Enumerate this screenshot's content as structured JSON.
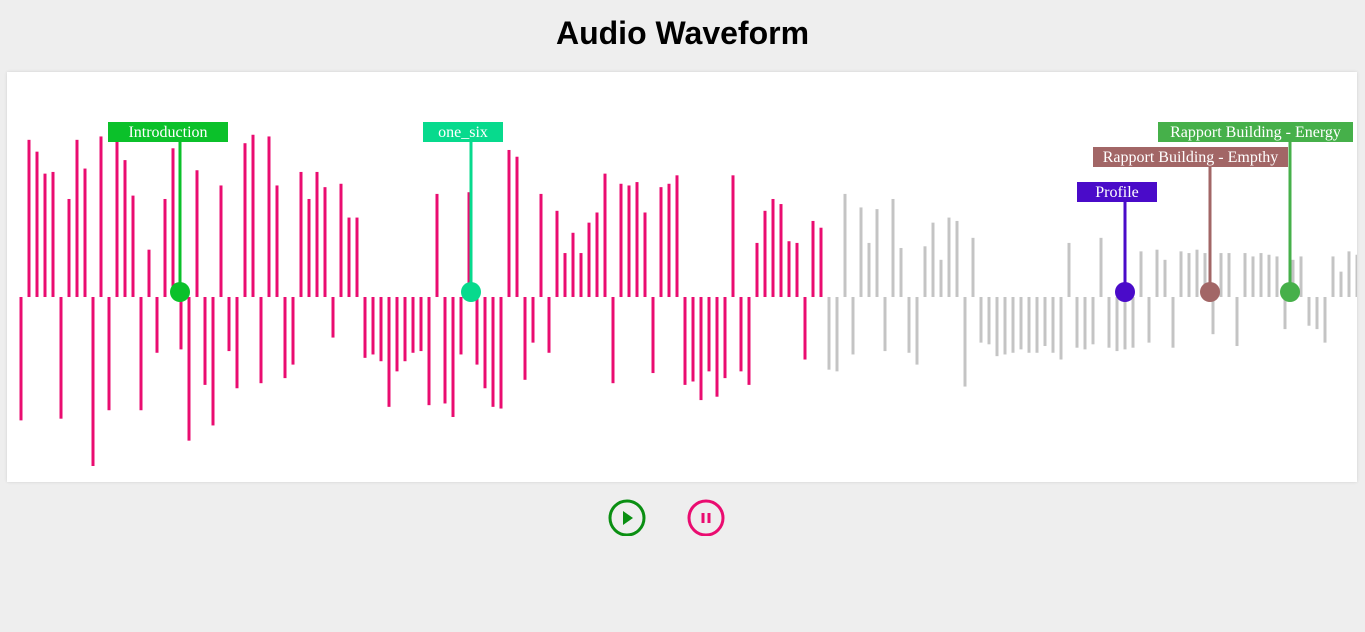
{
  "title": "Audio Waveform",
  "waveform": {
    "played_color": "#ea0c70",
    "unplayed_color": "#c4c4c4",
    "played_count": 101,
    "amplitudes": [
      -0.73,
      0.93,
      0.86,
      0.73,
      0.74,
      -0.72,
      0.58,
      0.93,
      0.76,
      -1.0,
      0.95,
      -0.67,
      0.93,
      0.81,
      0.6,
      -0.67,
      0.28,
      -0.33,
      0.58,
      0.88,
      -0.31,
      -0.85,
      0.75,
      -0.52,
      -0.76,
      0.66,
      -0.32,
      -0.54,
      0.91,
      0.96,
      -0.51,
      0.95,
      0.66,
      -0.48,
      -0.4,
      0.74,
      0.58,
      0.74,
      0.65,
      -0.24,
      0.67,
      0.47,
      0.47,
      -0.36,
      -0.34,
      -0.38,
      -0.65,
      -0.44,
      -0.38,
      -0.33,
      -0.32,
      -0.64,
      0.61,
      -0.63,
      -0.71,
      -0.34,
      0.62,
      -0.4,
      -0.54,
      -0.65,
      -0.66,
      0.87,
      0.83,
      -0.49,
      -0.27,
      0.61,
      -0.33,
      0.51,
      0.26,
      0.38,
      0.26,
      0.44,
      0.5,
      0.73,
      -0.51,
      0.67,
      0.66,
      0.68,
      0.5,
      -0.45,
      0.65,
      0.67,
      0.72,
      -0.52,
      -0.5,
      -0.61,
      -0.44,
      -0.59,
      -0.48,
      0.72,
      -0.44,
      -0.52,
      0.32,
      0.51,
      0.58,
      0.55,
      0.33,
      0.32,
      -0.37,
      0.45,
      0.41,
      -0.43,
      -0.44,
      0.61,
      -0.34,
      0.53,
      0.32,
      0.52,
      -0.32,
      0.58,
      0.29,
      -0.33,
      -0.4,
      0.3,
      0.44,
      0.22,
      0.47,
      0.45,
      -0.53,
      0.35,
      -0.27,
      -0.28,
      -0.35,
      -0.34,
      -0.33,
      -0.31,
      -0.33,
      -0.33,
      -0.29,
      -0.33,
      -0.37,
      0.32,
      -0.3,
      -0.31,
      -0.28,
      0.35,
      -0.3,
      -0.32,
      -0.31,
      -0.3,
      0.27,
      -0.27,
      0.28,
      0.22,
      -0.3,
      0.27,
      0.26,
      0.28,
      0.26,
      -0.22,
      0.26,
      0.26,
      -0.29,
      0.26,
      0.24,
      0.26,
      0.25,
      0.24,
      -0.19,
      0.22,
      0.24,
      -0.17,
      -0.19,
      -0.27,
      0.24,
      0.15,
      0.27,
      0.25,
      -0.13
    ]
  },
  "markers": [
    {
      "label": "Introduction",
      "color": "#0bc12a",
      "position": 0.128
    },
    {
      "label": "one_six",
      "color": "#07da8d",
      "position": 0.344
    },
    {
      "label": "Profile",
      "color": "#4a0bc9",
      "position": 0.828
    },
    {
      "label": "Rapport Building - Empthy",
      "color": "#a26666",
      "position": 0.891
    },
    {
      "label": "Rapport Building - Energy",
      "color": "#46b04a",
      "position": 0.95
    }
  ],
  "controls": {
    "play": {
      "icon": "play-icon",
      "color": "#0a8f12"
    },
    "pause": {
      "icon": "pause-icon",
      "color": "#ea0c70"
    }
  }
}
